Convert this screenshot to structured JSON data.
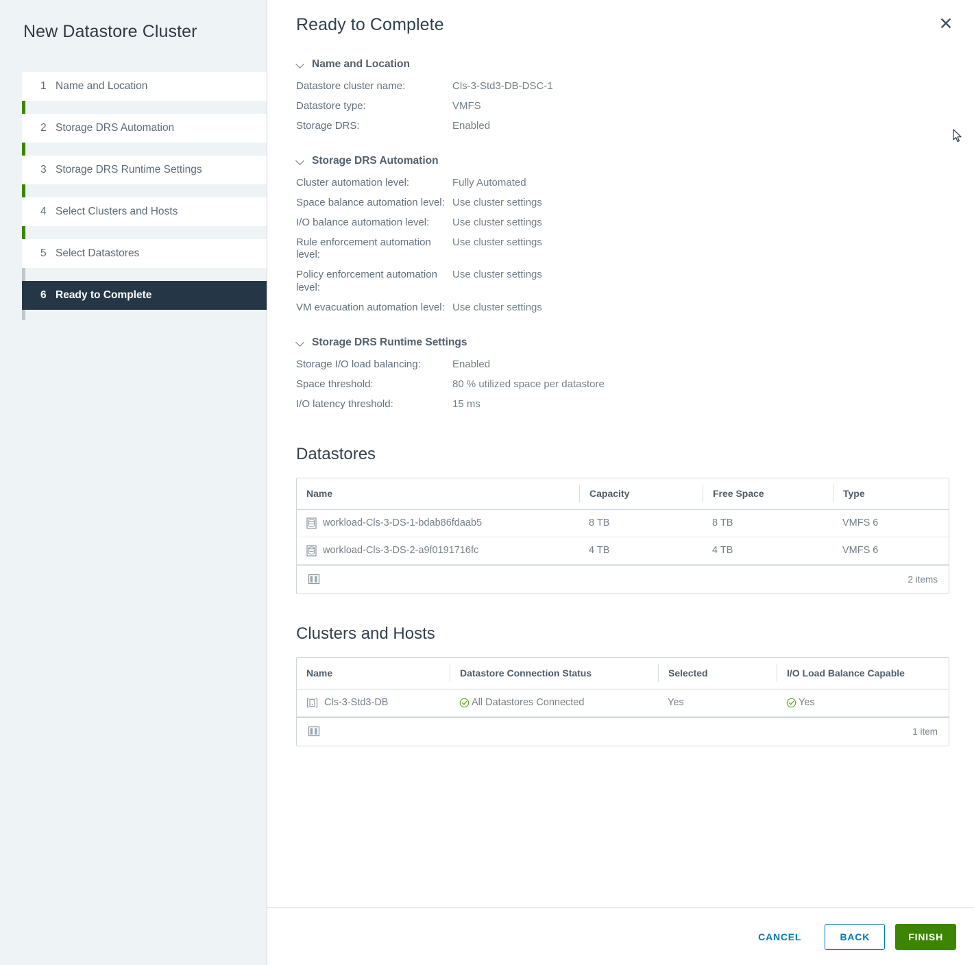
{
  "sidebar": {
    "title": "New Datastore Cluster",
    "steps": [
      {
        "num": "1",
        "label": "Name and Location"
      },
      {
        "num": "2",
        "label": "Storage DRS Automation"
      },
      {
        "num": "3",
        "label": "Storage DRS Runtime Settings"
      },
      {
        "num": "4",
        "label": "Select Clusters and Hosts"
      },
      {
        "num": "5",
        "label": "Select Datastores"
      },
      {
        "num": "6",
        "label": "Ready to Complete"
      }
    ],
    "active_index": 5
  },
  "header": {
    "title": "Ready to Complete",
    "close_label": "✕"
  },
  "sections": [
    {
      "title": "Name and Location",
      "rows": [
        {
          "key": "Datastore cluster name:",
          "value": "Cls-3-Std3-DB-DSC-1"
        },
        {
          "key": "Datastore type:",
          "value": "VMFS"
        },
        {
          "key": "Storage DRS:",
          "value": "Enabled"
        }
      ]
    },
    {
      "title": "Storage DRS Automation",
      "rows": [
        {
          "key": "Cluster automation level:",
          "value": "Fully Automated"
        },
        {
          "key": "Space balance automation level:",
          "value": "Use cluster settings"
        },
        {
          "key": "I/O balance automation level:",
          "value": "Use cluster settings"
        },
        {
          "key": "Rule enforcement automation level:",
          "value": "Use cluster settings"
        },
        {
          "key": "Policy enforcement automation level:",
          "value": "Use cluster settings"
        },
        {
          "key": "VM evacuation automation level:",
          "value": "Use cluster settings"
        }
      ]
    },
    {
      "title": "Storage DRS Runtime Settings",
      "rows": [
        {
          "key": "Storage I/O load balancing:",
          "value": "Enabled"
        },
        {
          "key": "Space threshold:",
          "value": "80 % utilized space per datastore"
        },
        {
          "key": "I/O latency threshold:",
          "value": "15 ms"
        }
      ]
    }
  ],
  "datastores_table": {
    "title": "Datastores",
    "columns": [
      "Name",
      "Capacity",
      "Free Space",
      "Type"
    ],
    "rows": [
      {
        "name": "workload-Cls-3-DS-1-bdab86fdaab5",
        "capacity": "8 TB",
        "free_space": "8 TB",
        "type": "VMFS 6"
      },
      {
        "name": "workload-Cls-3-DS-2-a9f0191716fc",
        "capacity": "4 TB",
        "free_space": "4 TB",
        "type": "VMFS 6"
      }
    ],
    "footer_count": "2 items"
  },
  "clusters_table": {
    "title": "Clusters and Hosts",
    "columns": [
      "Name",
      "Datastore Connection Status",
      "Selected",
      "I/O Load Balance Capable"
    ],
    "rows": [
      {
        "name": "Cls-3-Std3-DB",
        "connection_status": "All Datastores Connected",
        "selected": "Yes",
        "io_capable": "Yes"
      }
    ],
    "footer_count": "1 item"
  },
  "footer": {
    "cancel_label": "CANCEL",
    "back_label": "BACK",
    "finish_label": "FINISH"
  },
  "colors": {
    "accent_green": "#3c8500",
    "link_blue": "#0079b8",
    "active_step_bg": "#253746",
    "status_green": "#62a420"
  }
}
